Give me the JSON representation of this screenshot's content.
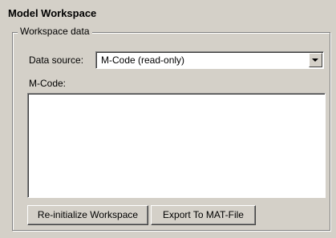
{
  "panel": {
    "title": "Model Workspace"
  },
  "workspace_group": {
    "legend": "Workspace data",
    "data_source_label": "Data source:",
    "data_source_value": "M-Code (read-only)",
    "mcode_label": "M-Code:",
    "mcode_text": ""
  },
  "buttons": {
    "reinitialize": "Re-initialize Workspace",
    "export": "Export To MAT-File"
  },
  "icons": {
    "dropdown": "chevron-down-icon"
  }
}
